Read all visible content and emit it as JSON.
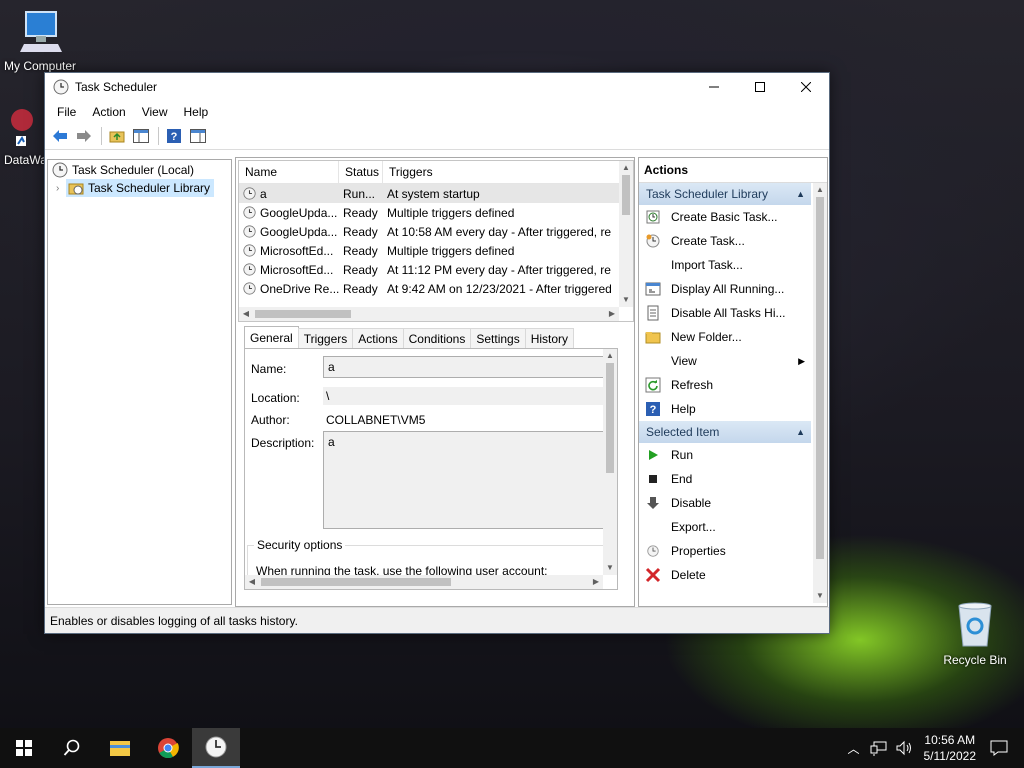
{
  "desktop": {
    "icons": [
      {
        "label": "My Computer"
      },
      {
        "label": "DataWa"
      },
      {
        "label": "Recycle Bin"
      }
    ]
  },
  "window": {
    "title": "Task Scheduler",
    "menu": [
      "File",
      "Action",
      "View",
      "Help"
    ],
    "tree": {
      "root": "Task Scheduler (Local)",
      "library": "Task Scheduler Library"
    },
    "tasks": {
      "columns": [
        "Name",
        "Status",
        "Triggers"
      ],
      "rows": [
        {
          "name": "a",
          "status": "Run...",
          "triggers": "At system startup"
        },
        {
          "name": "GoogleUpda...",
          "status": "Ready",
          "triggers": "Multiple triggers defined"
        },
        {
          "name": "GoogleUpda...",
          "status": "Ready",
          "triggers": "At 10:58 AM every day - After triggered, re"
        },
        {
          "name": "MicrosoftEd...",
          "status": "Ready",
          "triggers": "Multiple triggers defined"
        },
        {
          "name": "MicrosoftEd...",
          "status": "Ready",
          "triggers": "At 11:12 PM every day - After triggered, re"
        },
        {
          "name": "OneDrive Re...",
          "status": "Ready",
          "triggers": "At 9:42 AM on 12/23/2021 - After triggered"
        }
      ]
    },
    "tabs": [
      "General",
      "Triggers",
      "Actions",
      "Conditions",
      "Settings",
      "History"
    ],
    "general": {
      "name_label": "Name:",
      "name_value": "a",
      "location_label": "Location:",
      "location_value": "\\",
      "author_label": "Author:",
      "author_value": "COLLABNET\\VM5",
      "description_label": "Description:",
      "description_value": "a",
      "security_title": "Security options",
      "security_text": "When running the task, use the following user account:"
    },
    "actions": {
      "header": "Actions",
      "section1": "Task Scheduler Library",
      "items1": [
        {
          "label": "Create Basic Task...",
          "icon": "create-basic-task-icon"
        },
        {
          "label": "Create Task...",
          "icon": "create-task-icon"
        },
        {
          "label": "Import Task...",
          "icon": ""
        },
        {
          "label": "Display All Running...",
          "icon": "display-running-icon"
        },
        {
          "label": "Disable All Tasks Hi...",
          "icon": "disable-history-icon"
        },
        {
          "label": "New Folder...",
          "icon": "folder-icon"
        },
        {
          "label": "View",
          "icon": ""
        },
        {
          "label": "Refresh",
          "icon": "refresh-icon"
        },
        {
          "label": "Help",
          "icon": "help-icon"
        }
      ],
      "section2": "Selected Item",
      "items2": [
        {
          "label": "Run",
          "icon": "run-icon"
        },
        {
          "label": "End",
          "icon": "end-icon"
        },
        {
          "label": "Disable",
          "icon": "disable-icon"
        },
        {
          "label": "Export...",
          "icon": ""
        },
        {
          "label": "Properties",
          "icon": "properties-icon"
        },
        {
          "label": "Delete",
          "icon": "delete-icon"
        }
      ]
    },
    "status_text": "Enables or disables logging of all tasks history."
  },
  "taskbar": {
    "time": "10:56 AM",
    "date": "5/11/2022"
  },
  "colors": {
    "selection": "#cce8ff",
    "section_header": "#c4d7ec",
    "taskbar": "#101010"
  }
}
